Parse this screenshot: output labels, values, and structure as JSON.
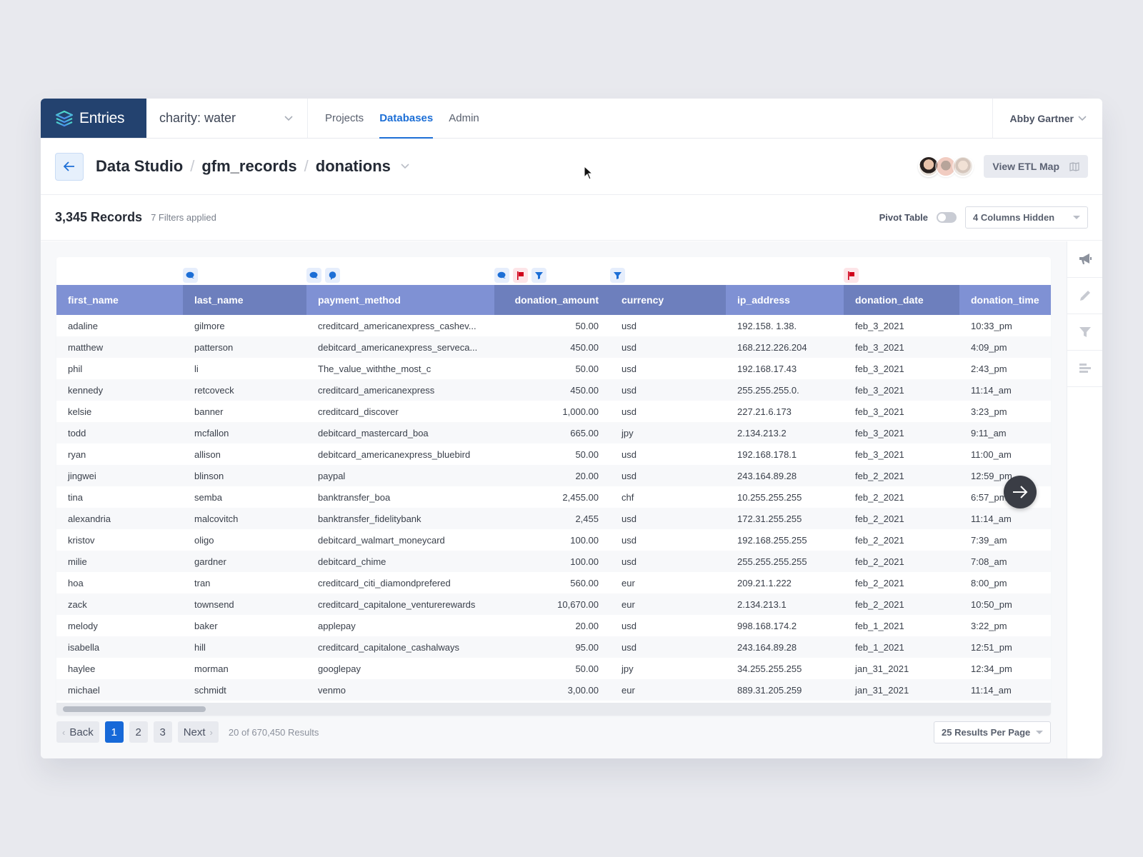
{
  "brand": {
    "name": "Entries",
    "color": "#23426f"
  },
  "org_selector": {
    "value": "charity: water"
  },
  "nav": {
    "tabs": [
      {
        "label": "Projects",
        "active": false
      },
      {
        "label": "Databases",
        "active": true
      },
      {
        "label": "Admin",
        "active": false
      }
    ],
    "user_name": "Abby Gartner"
  },
  "breadcrumb": {
    "items": [
      "Data Studio",
      "gfm_records",
      "donations"
    ],
    "separator": "/"
  },
  "header_actions": {
    "etl_button": "View ETL Map",
    "collaborator_count": 3
  },
  "records_bar": {
    "count": "3,345 Records",
    "filters": "7 Filters applied",
    "pivot_label": "Pivot Table",
    "pivot_on": false,
    "columns_hidden": "4 Columns Hidden"
  },
  "table": {
    "columns": [
      "first_name",
      "last_name",
      "payment_method",
      "donation_amount",
      "currency",
      "ip_address",
      "donation_date",
      "donation_time"
    ],
    "column_icons": {
      "last_name": [
        "comment"
      ],
      "payment_method": [
        "comment",
        "chat"
      ],
      "donation_amount": [
        "comment",
        "flag",
        "filter"
      ],
      "currency": [
        "filter"
      ],
      "donation_date": [
        "flag"
      ]
    },
    "rows": [
      [
        "adaline",
        "gilmore",
        "creditcard_americanexpress_cashev...",
        "50.00",
        "usd",
        "192.158. 1.38.",
        "feb_3_2021",
        "10:33_pm"
      ],
      [
        "matthew",
        "patterson",
        "debitcard_americanexpress_serveca...",
        "450.00",
        "usd",
        "168.212.226.204",
        "feb_3_2021",
        "4:09_pm"
      ],
      [
        "phil",
        "li",
        "The_value_withthe_most_c",
        "50.00",
        "usd",
        "192.168.17.43",
        "feb_3_2021",
        "2:43_pm"
      ],
      [
        "kennedy",
        "retcoveck",
        "creditcard_americanexpress",
        "450.00",
        "usd",
        "255.255.255.0.",
        "feb_3_2021",
        "11:14_am"
      ],
      [
        "kelsie",
        "banner",
        "creditcard_discover",
        "1,000.00",
        "usd",
        "227.21.6.173",
        "feb_3_2021",
        "3:23_pm"
      ],
      [
        "todd",
        "mcfallon",
        "debitcard_mastercard_boa",
        "665.00",
        "jpy",
        "2.134.213.2",
        "feb_3_2021",
        "9:11_am"
      ],
      [
        "ryan",
        "allison",
        "debitcard_americanexpress_bluebird",
        "50.00",
        "usd",
        "192.168.178.1",
        "feb_3_2021",
        "11:00_am"
      ],
      [
        "jingwei",
        "blinson",
        "paypal",
        "20.00",
        "usd",
        "243.164.89.28",
        "feb_2_2021",
        "12:59_pm"
      ],
      [
        "tina",
        "semba",
        "banktransfer_boa",
        "2,455.00",
        "chf",
        "10.255.255.255",
        "feb_2_2021",
        "6:57_pm"
      ],
      [
        "alexandria",
        "malcovitch",
        "banktransfer_fidelitybank",
        "2,455",
        "usd",
        "172.31.255.255",
        "feb_2_2021",
        "11:14_am"
      ],
      [
        "kristov",
        "oligo",
        "debitcard_walmart_moneycard",
        "100.00",
        "usd",
        "192.168.255.255",
        "feb_2_2021",
        "7:39_am"
      ],
      [
        "milie",
        "gardner",
        "debitcard_chime",
        "100.00",
        "usd",
        "255.255.255.255",
        "feb_2_2021",
        "7:08_am"
      ],
      [
        "hoa",
        "tran",
        "creditcard_citi_diamondprefered",
        "560.00",
        "eur",
        "209.21.1.222",
        "feb_2_2021",
        "8:00_pm"
      ],
      [
        "zack",
        "townsend",
        "creditcard_capitalone_venturerewards",
        "10,670.00",
        "eur",
        "2.134.213.1",
        "feb_2_2021",
        "10:50_pm"
      ],
      [
        "melody",
        "baker",
        "applepay",
        "20.00",
        "usd",
        "998.168.174.2",
        "feb_1_2021",
        "3:22_pm"
      ],
      [
        "isabella",
        "hill",
        "creditcard_capitalone_cashalways",
        "95.00",
        "usd",
        "243.164.89.28",
        "feb_1_2021",
        "12:51_pm"
      ],
      [
        "haylee",
        "morman",
        "googlepay",
        "50.00",
        "jpy",
        "34.255.255.255",
        "jan_31_2021",
        "12:34_pm"
      ],
      [
        "michael",
        "schmidt",
        "venmo",
        "3,00.00",
        "eur",
        "889.31.205.259",
        "jan_31_2021",
        "11:14_am"
      ]
    ]
  },
  "pagination": {
    "back": "Back",
    "next": "Next",
    "pages": [
      "1",
      "2",
      "3"
    ],
    "current": "1",
    "summary": "20 of 670,450 Results",
    "per_page": "25 Results Per Page"
  },
  "sidebar_tools": [
    "announcement-icon",
    "pencil-icon",
    "filter-icon",
    "align-icon"
  ],
  "colors": {
    "accent": "#1d6fd6",
    "header_light": "#7f91d4",
    "header_dark": "#6d7fbd",
    "flag_red": "#d0021b"
  }
}
